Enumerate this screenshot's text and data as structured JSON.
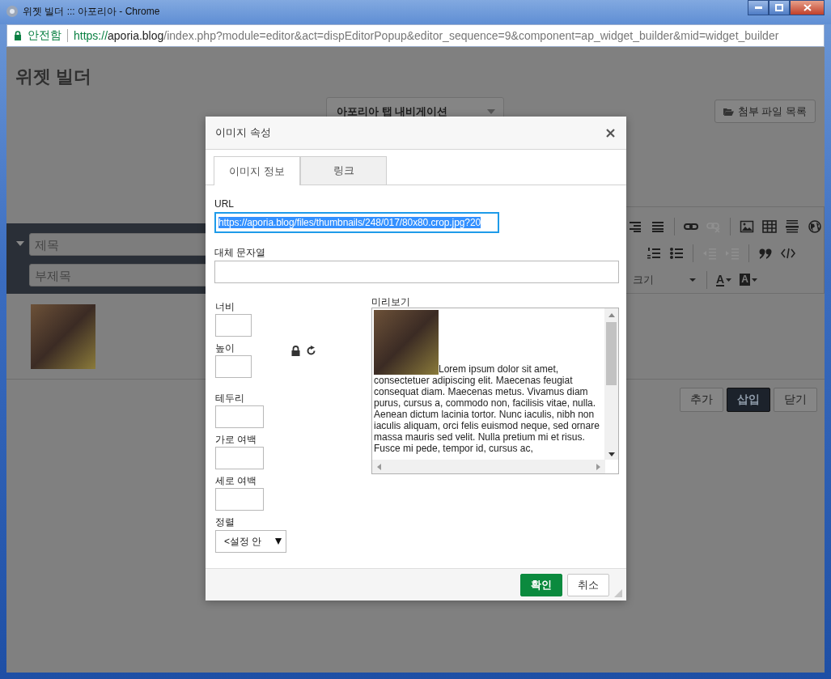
{
  "window": {
    "title": "위젯 빌더 ::: 아포리아 - Chrome"
  },
  "address_bar": {
    "security": "안전함",
    "scheme": "https://",
    "host": "aporia.blog",
    "path": "/index.php?module=editor&act=dispEditorPopup&editor_sequence=9&component=ap_widget_builder&mid=widget_builder"
  },
  "page": {
    "title": "위젯 빌더",
    "widget_select": "아포리아 탭 내비게이션",
    "attach_button": "첨부 파일 목록",
    "subject_placeholder": "제목",
    "subtitle_placeholder": "부제목",
    "toolbar": {
      "rows": [
        [
          [
            {
              "kind": "align-right",
              "disabled": false
            },
            {
              "kind": "justify",
              "disabled": false
            }
          ],
          [
            {
              "kind": "link",
              "disabled": false
            },
            {
              "kind": "unlink",
              "disabled": true
            }
          ],
          [
            {
              "kind": "image",
              "disabled": false
            },
            {
              "kind": "table",
              "disabled": false
            },
            {
              "kind": "rule",
              "disabled": false
            },
            {
              "kind": "globe",
              "disabled": false
            }
          ]
        ],
        [
          [
            {
              "kind": "ordered-list",
              "disabled": false
            },
            {
              "kind": "bullet-list",
              "disabled": false
            }
          ],
          [
            {
              "kind": "outdent",
              "disabled": true
            },
            {
              "kind": "indent",
              "disabled": true
            }
          ],
          [
            {
              "kind": "quote",
              "disabled": false
            },
            {
              "kind": "code",
              "disabled": false
            }
          ]
        ],
        [
          [
            {
              "kind": "select",
              "label": "크기",
              "disabled": false
            }
          ],
          [
            {
              "kind": "font-color",
              "glyph": "A",
              "disabled": false
            },
            {
              "kind": "bg-color",
              "glyph": "A",
              "disabled": false
            }
          ]
        ]
      ]
    },
    "buttons": [
      {
        "label": "추가",
        "primary": false
      },
      {
        "label": "삽입",
        "primary": true
      },
      {
        "label": "닫기",
        "primary": false
      }
    ]
  },
  "dialog": {
    "title": "이미지 속성",
    "tabs": [
      {
        "label": "이미지 정보",
        "selected": true
      },
      {
        "label": "링크",
        "selected": false
      }
    ],
    "url": {
      "label": "URL",
      "value": "https://aporia.blog/files/thumbnails/248/017/80x80.crop.jpg?20",
      "text_selected": true
    },
    "alt": {
      "label": "대체 문자열"
    },
    "width": {
      "label": "너비"
    },
    "height": {
      "label": "높이"
    },
    "border": {
      "label": "테두리"
    },
    "hspace": {
      "label": "가로 여백"
    },
    "vspace": {
      "label": "세로 여백"
    },
    "align": {
      "label": "정렬",
      "value": "<설정 안"
    },
    "preview": {
      "label": "미리보기",
      "text": "Lorem ipsum dolor sit amet, consectetuer adipiscing elit. Maecenas feugiat consequat diam. Maecenas metus. Vivamus diam purus, cursus a, commodo non, facilisis vitae, nulla. Aenean dictum lacinia tortor. Nunc iaculis, nibh non iaculis aliquam, orci felis euismod neque, sed ornare massa mauris sed velit. Nulla pretium mi et risus. Fusce mi pede, tempor id, cursus ac,"
    },
    "buttons": [
      {
        "label": "확인",
        "primary": true
      },
      {
        "label": "취소",
        "primary": false
      }
    ]
  }
}
